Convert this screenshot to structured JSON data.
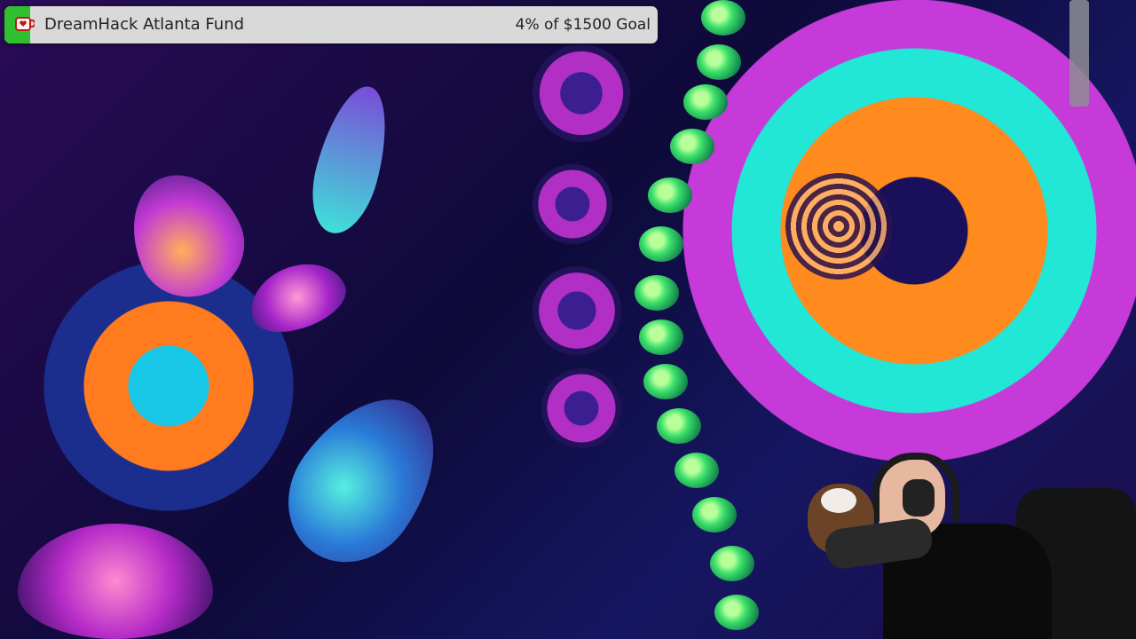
{
  "goal": {
    "title": "DreamHack Atlanta Fund",
    "progress_text": "4% of $1500 Goal",
    "percent": 4,
    "icon": "tip-jar-icon",
    "colors": {
      "fill": "#2fc02f",
      "bar": "#d9d9d9",
      "text": "#222222"
    }
  },
  "webcam": {
    "icon": "webcam-overlay"
  }
}
